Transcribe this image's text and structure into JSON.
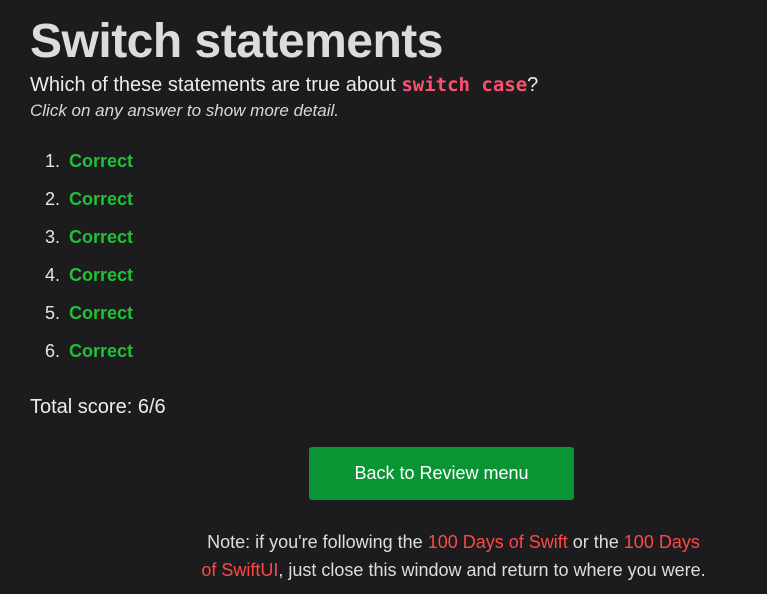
{
  "page": {
    "title": "Switch statements",
    "question_prefix": "Which of these statements are true about ",
    "question_code": "switch case",
    "question_suffix": "?",
    "hint": "Click on any answer to show more detail."
  },
  "answers": [
    {
      "number": "1.",
      "result": "Correct"
    },
    {
      "number": "2.",
      "result": "Correct"
    },
    {
      "number": "3.",
      "result": "Correct"
    },
    {
      "number": "4.",
      "result": "Correct"
    },
    {
      "number": "5.",
      "result": "Correct"
    },
    {
      "number": "6.",
      "result": "Correct"
    }
  ],
  "score": {
    "text": "Total score: 6/6"
  },
  "button": {
    "label": "Back to Review menu"
  },
  "note": {
    "prefix": "Note: if you're following the ",
    "link1": "100 Days of Swift",
    "middle": " or the ",
    "link2": "100 Days of SwiftUI",
    "suffix": ", just close this window and return to where you were."
  },
  "colors": {
    "background": "#1c1c1e",
    "correct": "#22c035",
    "code": "#ff4f6d",
    "button": "#0a9535",
    "link": "#ff4747"
  }
}
